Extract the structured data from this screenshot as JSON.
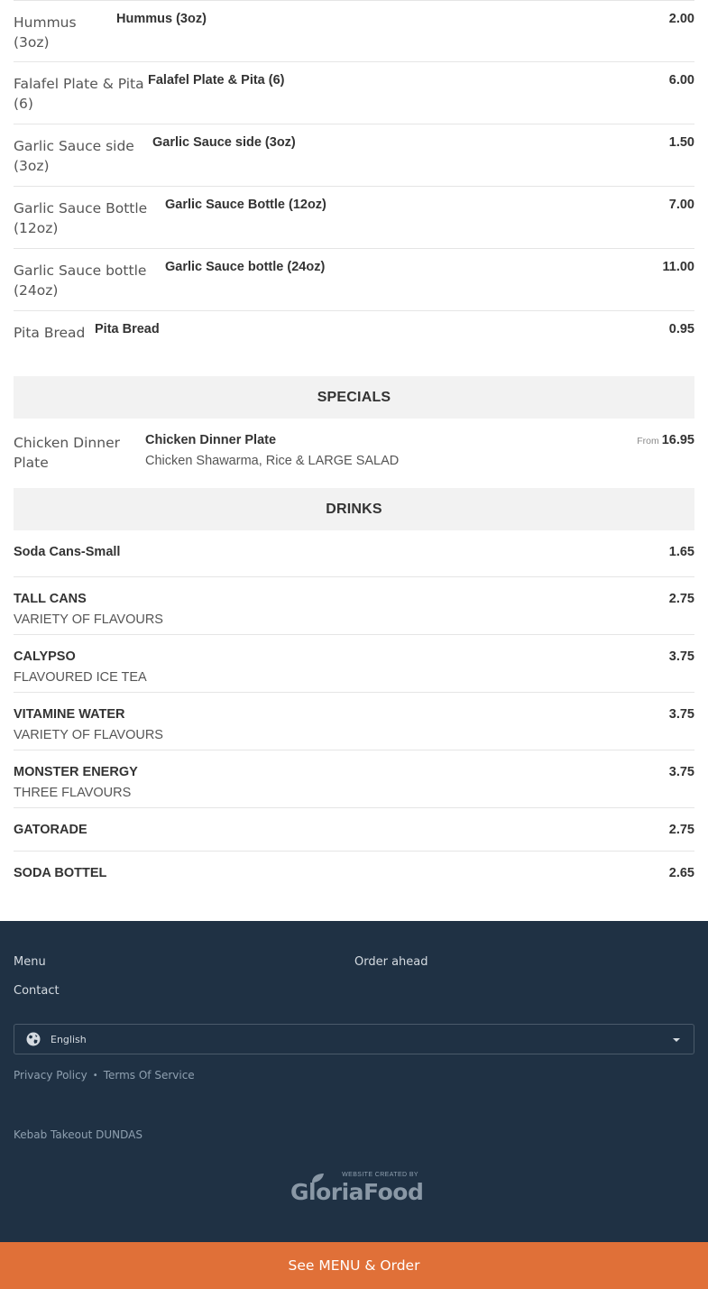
{
  "menu_items": [
    {
      "img_alt": "Hummus (3oz)",
      "name": "Hummus (3oz)",
      "price": "2.00"
    },
    {
      "img_alt": "Falafel Plate & Pita (6)",
      "name": "Falafel Plate & Pita (6)",
      "price": "6.00"
    },
    {
      "img_alt": "Garlic Sauce side (3oz)",
      "name": "Garlic Sauce side (3oz)",
      "price": "1.50"
    },
    {
      "img_alt": "Garlic Sauce Bottle (12oz)",
      "name": "Garlic Sauce Bottle (12oz)",
      "price": "7.00"
    },
    {
      "img_alt": "Garlic Sauce bottle (24oz)",
      "name": "Garlic Sauce bottle (24oz)",
      "price": "11.00"
    },
    {
      "img_alt": "Pita Bread",
      "name": "Pita Bread",
      "price": "0.95"
    }
  ],
  "specials": {
    "title": "SPECIALS",
    "items": [
      {
        "img_alt": "Chicken Dinner Plate",
        "name": "Chicken Dinner Plate",
        "description": "Chicken Shawarma, Rice & LARGE SALAD",
        "price_prefix": "From",
        "price": "16.95"
      }
    ]
  },
  "drinks": {
    "title": "DRINKS",
    "items": [
      {
        "name": "Soda Cans-Small",
        "description": "",
        "price": "1.65"
      },
      {
        "name": "TALL CANS",
        "description": "VARIETY OF FLAVOURS",
        "price": "2.75"
      },
      {
        "name": "CALYPSO",
        "description": "FLAVOURED ICE TEA",
        "price": "3.75"
      },
      {
        "name": "VITAMINE WATER",
        "description": "VARIETY OF FLAVOURS",
        "price": "3.75"
      },
      {
        "name": "MONSTER ENERGY",
        "description": "THREE FLAVOURS",
        "price": "3.75"
      },
      {
        "name": "GATORADE",
        "description": "",
        "price": "2.75"
      },
      {
        "name": "SODA BOTTEL",
        "description": "",
        "price": "2.65"
      }
    ]
  },
  "footer": {
    "links": {
      "menu": "Menu",
      "order_ahead": "Order ahead",
      "contact": "Contact"
    },
    "language": {
      "icon": "globe-icon",
      "selected": "English"
    },
    "legal": {
      "privacy": "Privacy Policy",
      "separator": "•",
      "terms": "Terms Of Service"
    },
    "business_name": "Kebab Takeout DUNDAS",
    "credit": {
      "small": "WEBSITE CREATED BY",
      "brand": "GloriaFood"
    },
    "background": "#1f3144"
  },
  "cta": {
    "label": "See MENU & Order",
    "color": "#e07038"
  }
}
